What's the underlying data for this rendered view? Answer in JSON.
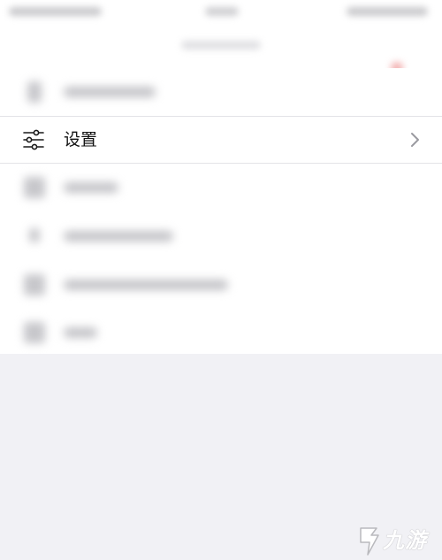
{
  "settings_row": {
    "label": "设置",
    "icon": "sliders-icon",
    "trailing_icon": "chevron-right-icon"
  },
  "watermark": {
    "text": "九游"
  }
}
